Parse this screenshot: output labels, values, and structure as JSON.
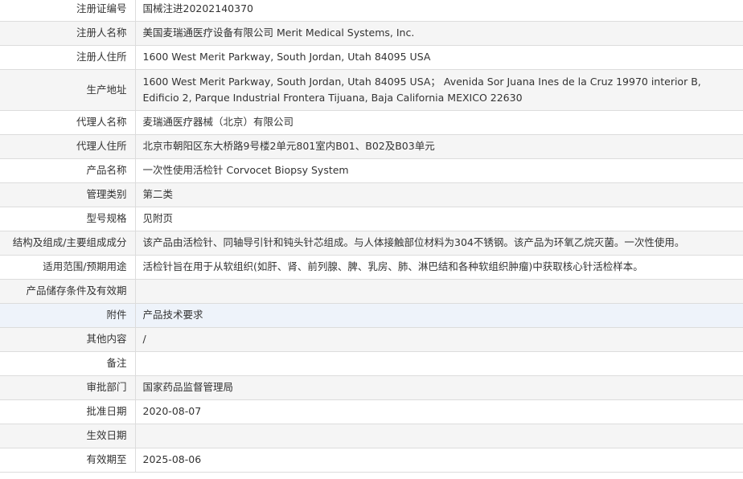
{
  "rows": [
    {
      "label": "注册证编号",
      "value": "国械注进20202140370"
    },
    {
      "label": "注册人名称",
      "value": "美国麦瑞通医疗设备有限公司 Merit Medical Systems, Inc."
    },
    {
      "label": "注册人住所",
      "value": "1600 West Merit Parkway, South Jordan, Utah 84095 USA"
    },
    {
      "label": "生产地址",
      "value": "1600 West Merit Parkway, South Jordan, Utah 84095 USA； Avenida Sor Juana Ines de la Cruz 19970 interior B, Edificio 2, Parque Industrial Frontera Tijuana, Baja California MEXICO 22630"
    },
    {
      "label": "代理人名称",
      "value": "麦瑞通医疗器械（北京）有限公司"
    },
    {
      "label": "代理人住所",
      "value": "北京市朝阳区东大桥路9号楼2单元801室内B01、B02及B03单元"
    },
    {
      "label": "产品名称",
      "value": "一次性使用活检针 Corvocet Biopsy System"
    },
    {
      "label": "管理类别",
      "value": "第二类"
    },
    {
      "label": "型号规格",
      "value": "见附页"
    },
    {
      "label": "结构及组成/主要组成成分",
      "value": "该产品由活检针、同轴导引针和钝头针芯组成。与人体接触部位材料为304不锈钢。该产品为环氧乙烷灭菌。一次性使用。"
    },
    {
      "label": "适用范围/预期用途",
      "value": "活检针旨在用于从软组织(如肝、肾、前列腺、脾、乳房、肺、淋巴结和各种软组织肿瘤)中获取核心针活检样本。"
    },
    {
      "label": "产品储存条件及有效期",
      "value": ""
    },
    {
      "label": "附件",
      "value": "产品技术要求"
    },
    {
      "label": "其他内容",
      "value": "/"
    },
    {
      "label": "备注",
      "value": ""
    },
    {
      "label": "审批部门",
      "value": "国家药品监督管理局"
    },
    {
      "label": "批准日期",
      "value": "2020-08-07"
    },
    {
      "label": "生效日期",
      "value": ""
    },
    {
      "label": "有效期至",
      "value": "2025-08-06"
    }
  ]
}
